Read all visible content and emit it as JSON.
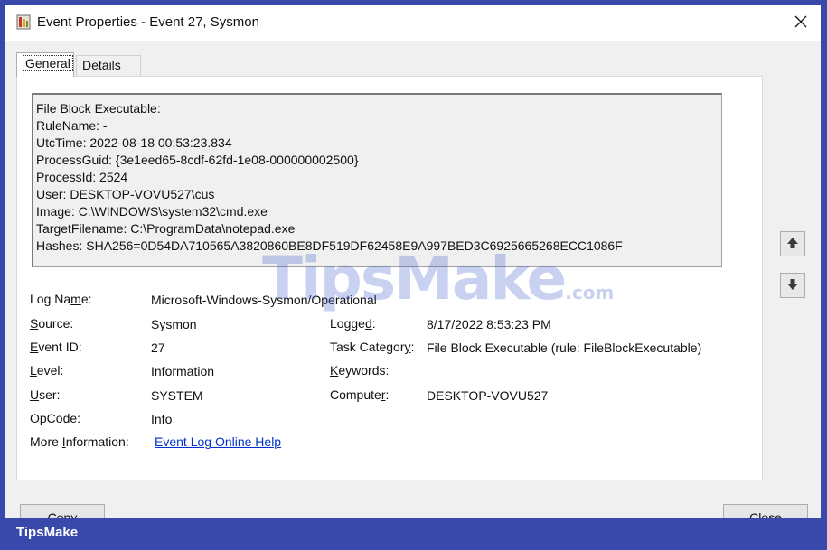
{
  "window": {
    "title": "Event Properties - Event 27, Sysmon",
    "icons": {
      "app": "event-log-icon",
      "close": "close-icon"
    }
  },
  "tabs": [
    {
      "label": "General",
      "active": true
    },
    {
      "label": "Details",
      "active": false
    }
  ],
  "description": [
    "File Block Executable:",
    "RuleName: -",
    "UtcTime: 2022-08-18 00:53:23.834",
    "ProcessGuid: {3e1eed65-8cdf-62fd-1e08-000000002500}",
    "ProcessId: 2524",
    "User: DESKTOP-VOVU527\\cus",
    "Image: C:\\WINDOWS\\system32\\cmd.exe",
    "TargetFilename: C:\\ProgramData\\notepad.exe",
    "Hashes: SHA256=0D54DA710565A3820860BE8DF519DF62458E9A997BED3C6925665268ECC1086F"
  ],
  "fields": {
    "log_name": {
      "label_pre": "Log Na",
      "label_u": "m",
      "label_post": "e:",
      "value": "Microsoft-Windows-Sysmon/Operational"
    },
    "source": {
      "label_pre": "",
      "label_u": "S",
      "label_post": "ource:",
      "value": "Sysmon"
    },
    "event_id": {
      "label_pre": "",
      "label_u": "E",
      "label_post": "vent ID:",
      "value": "27"
    },
    "level": {
      "label_pre": "",
      "label_u": "L",
      "label_post": "evel:",
      "value": "Information"
    },
    "user": {
      "label_pre": "",
      "label_u": "U",
      "label_post": "ser:",
      "value": "SYSTEM"
    },
    "opcode": {
      "label_pre": "",
      "label_u": "O",
      "label_post": "pCode:",
      "value": "Info"
    },
    "more_info": {
      "label_pre": "More ",
      "label_u": "I",
      "label_post": "nformation:",
      "link": "Event Log Online Help"
    },
    "logged": {
      "label_pre": "Logge",
      "label_u": "d",
      "label_post": ":",
      "value": "8/17/2022 8:53:23 PM"
    },
    "task_category": {
      "label_pre": "Task Categor",
      "label_u": "y",
      "label_post": ":",
      "value": "File Block Executable (rule: FileBlockExecutable)"
    },
    "keywords": {
      "label_pre": "",
      "label_u": "K",
      "label_post": "eywords:",
      "value": ""
    },
    "computer": {
      "label_pre": "Compute",
      "label_u": "r",
      "label_post": ":",
      "value": "DESKTOP-VOVU527"
    }
  },
  "buttons": {
    "copy": "Copy",
    "close": "Close",
    "up_icon": "arrow-up-icon",
    "down_icon": "arrow-down-icon"
  },
  "watermark": {
    "main": "TipsMake",
    "suffix": ".com"
  },
  "footer": {
    "brand": "TipsMake"
  },
  "colors": {
    "link": "#0033cc",
    "frame": "#3949ab"
  }
}
